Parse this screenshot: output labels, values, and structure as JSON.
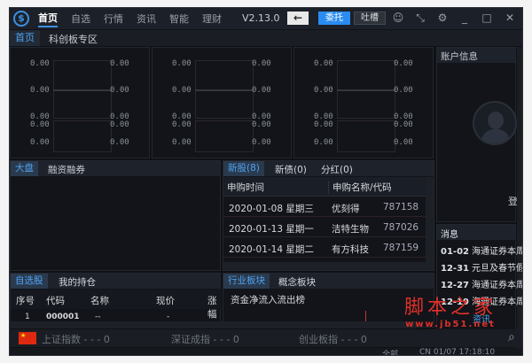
{
  "titlebar": {
    "logo": "卐",
    "nav": [
      "首页",
      "自选",
      "行情",
      "资讯",
      "智能",
      "理财"
    ],
    "active": "首页",
    "version": "V2.13.0",
    "back_icon": "arrow-left-icon",
    "entrust": "委托",
    "feedback": "吐槽",
    "icons": [
      "chat-icon",
      "shrink-icon",
      "gear-icon",
      "minimize-icon",
      "maximize-icon",
      "close-icon"
    ]
  },
  "subtabs": [
    "首页",
    "科创板专区"
  ],
  "charts": [
    {
      "rows": [
        "0.00",
        "0.00",
        "0.00",
        "0.00",
        "0.00"
      ],
      "right": [
        "0.00",
        "0.00",
        "0.00",
        "0.00",
        "0.00"
      ]
    },
    {
      "rows": [
        "0.00",
        "0.00",
        "0.00",
        "0.00",
        "0.00"
      ],
      "right": [
        "0.00",
        "0.00",
        "0.00",
        "0.00",
        "0.00"
      ]
    },
    {
      "rows": [
        "0.00",
        "0.00",
        "0.00",
        "0.00",
        "0.00"
      ],
      "right": [
        "0.00",
        "0.00",
        "0.00",
        "0.00",
        "0.00"
      ]
    }
  ],
  "account": {
    "title": "账户信息",
    "login": "登"
  },
  "market": {
    "tabs": [
      "大盘",
      "融资融券"
    ]
  },
  "ipo": {
    "tabs": [
      "新股(8)",
      "新债(0)",
      "分红(0)"
    ],
    "headers": [
      "申购时间",
      "申购名称/代码"
    ],
    "rows": [
      [
        "2020-01-08 星期三",
        "优刻得",
        "787158"
      ],
      [
        "2020-01-13 星期一",
        "洁特生物",
        "787026"
      ],
      [
        "2020-01-14 星期二",
        "有方科技",
        "787159"
      ]
    ]
  },
  "messages": {
    "title": "消息",
    "items": [
      [
        "01-02",
        "海通证券本周"
      ],
      [
        "12-31",
        "元旦及春节假"
      ],
      [
        "12-27",
        "海通证券本周"
      ],
      [
        "12-19",
        "海通证券本周"
      ]
    ],
    "footer": "资讯"
  },
  "watch": {
    "tabs": [
      "自选股",
      "我的持仓"
    ],
    "headers": [
      "序号",
      "代码",
      "名称",
      "现价",
      "涨幅"
    ],
    "row": [
      "1",
      "000001",
      "--",
      "-"
    ]
  },
  "sector": {
    "tabs": [
      "行业板块",
      "概念板块"
    ],
    "subtitle": "资金净流入流出榜"
  },
  "indices": [
    {
      "name": "上证指数",
      "value": "- - - 0"
    },
    {
      "name": "深证成指",
      "value": "- - - 0"
    },
    {
      "name": "创业板指",
      "value": "- - - 0"
    }
  ],
  "status": {
    "filter": "全部",
    "time": "CN 01/07 17:18:10"
  },
  "watermark": {
    "title": "脚本之家",
    "url": "www.jb51.net"
  },
  "colors": {
    "accent": "#2a8cf0",
    "bg": "#0f1115"
  }
}
